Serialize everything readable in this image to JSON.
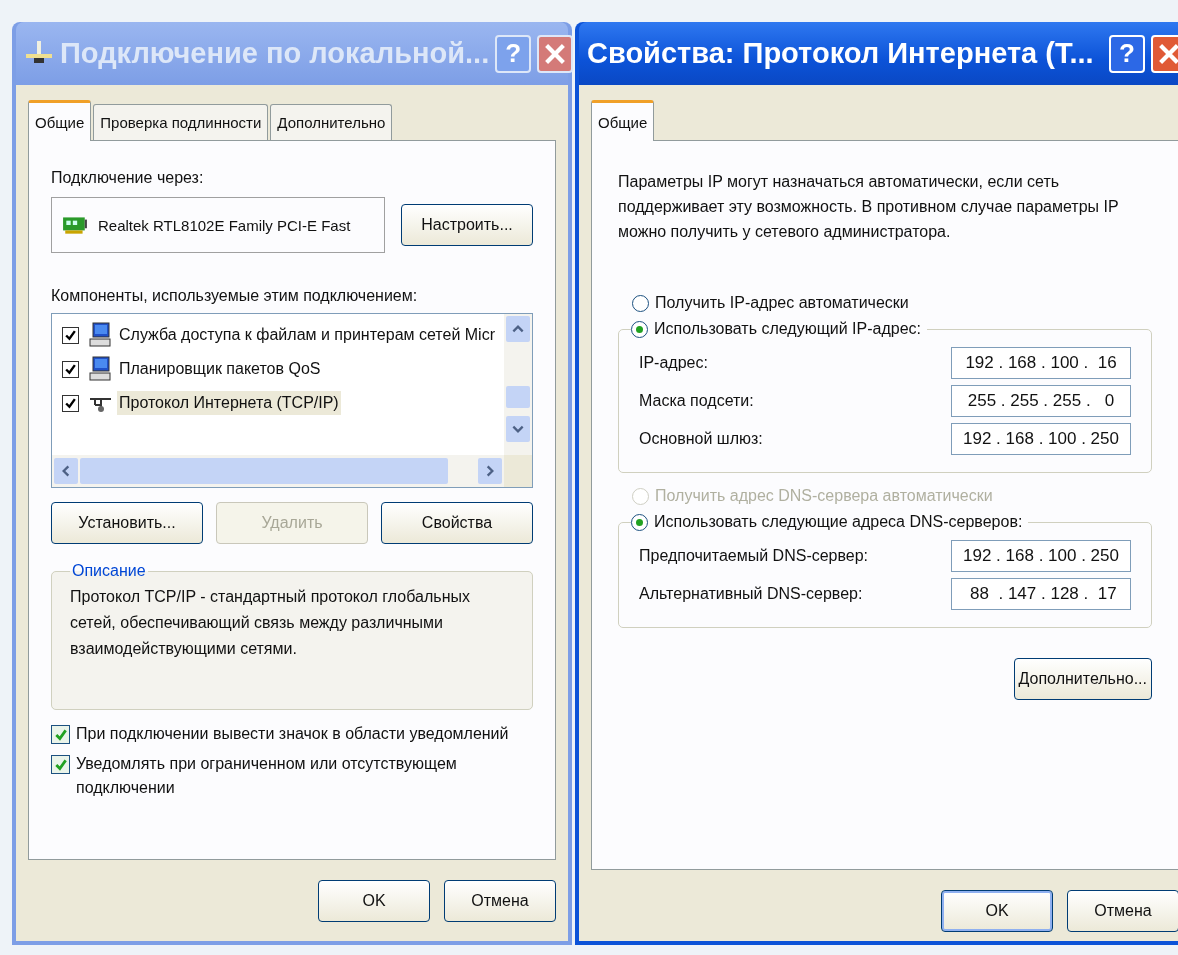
{
  "left_window": {
    "title": "Подключение по локальной...",
    "active": false,
    "help_button": "?",
    "tabs": [
      {
        "label": "Общие",
        "selected": true
      },
      {
        "label": "Проверка подлинности",
        "selected": false
      },
      {
        "label": "Дополнительно",
        "selected": false
      }
    ],
    "connect_via_label": "Подключение через:",
    "adapter": "Realtek RTL8102E Family PCI-E Fast",
    "configure_button": "Настроить...",
    "components_label": "Компоненты, используемые этим подключением:",
    "components": [
      {
        "name": "Служба доступа к файлам и принтерам сетей Micr",
        "kind": "service",
        "checked": true,
        "selected": false
      },
      {
        "name": "Планировщик пакетов QoS",
        "kind": "service",
        "checked": true,
        "selected": false
      },
      {
        "name": "Протокол Интернета (TCP/IP)",
        "kind": "protocol",
        "checked": true,
        "selected": true
      }
    ],
    "component_buttons": [
      {
        "label": "Установить...",
        "disabled": false
      },
      {
        "label": "Удалить",
        "disabled": true
      },
      {
        "label": "Свойства",
        "disabled": false
      }
    ],
    "description": {
      "title": "Описание",
      "text": "Протокол TCP/IP - стандартный протокол глобальных сетей, обеспечивающий связь между различными взаимодействующими сетями."
    },
    "options": [
      {
        "label": "При подключении вывести значок в области уведомлений",
        "checked": true
      },
      {
        "label": "Уведомлять при ограниченном или отсутствующем подключении",
        "checked": true
      }
    ],
    "buttons": [
      "OK",
      "Отмена"
    ]
  },
  "right_window": {
    "title": "Свойства: Протокол Интернета (Т...",
    "active": true,
    "help_button": "?",
    "tabs": [
      {
        "label": "Общие",
        "selected": true
      }
    ],
    "intro": "Параметры IP могут назначаться автоматически, если сеть поддерживает эту возможность. В противном случае параметры IP можно получить у сетевого администратора.",
    "ip_mode": [
      {
        "label": "Получить IP-адрес автоматически",
        "selected": false,
        "disabled": false
      },
      {
        "label": "Использовать следующий IP-адрес:",
        "selected": true,
        "disabled": false
      }
    ],
    "ip_fields": [
      {
        "label": "IP-адрес:",
        "value": "192 . 168 . 100 .  16"
      },
      {
        "label": "Маска подсети:",
        "value": "255 . 255 . 255 .   0"
      },
      {
        "label": "Основной шлюз:",
        "value": "192 . 168 . 100 . 250"
      }
    ],
    "dns_mode": [
      {
        "label": "Получить адрес DNS-сервера автоматически",
        "selected": false,
        "disabled": true
      },
      {
        "label": "Использовать следующие адреса DNS-серверов:",
        "selected": true,
        "disabled": false
      }
    ],
    "dns_fields": [
      {
        "label": "Предпочитаемый DNS-сервер:",
        "value": "192 . 168 . 100 . 250"
      },
      {
        "label": "Альтернативный DNS-сервер:",
        "value": " 88  . 147 . 128 .  17"
      }
    ],
    "advanced_button": "Дополнительно...",
    "buttons": [
      "OK",
      "Отмена"
    ]
  }
}
